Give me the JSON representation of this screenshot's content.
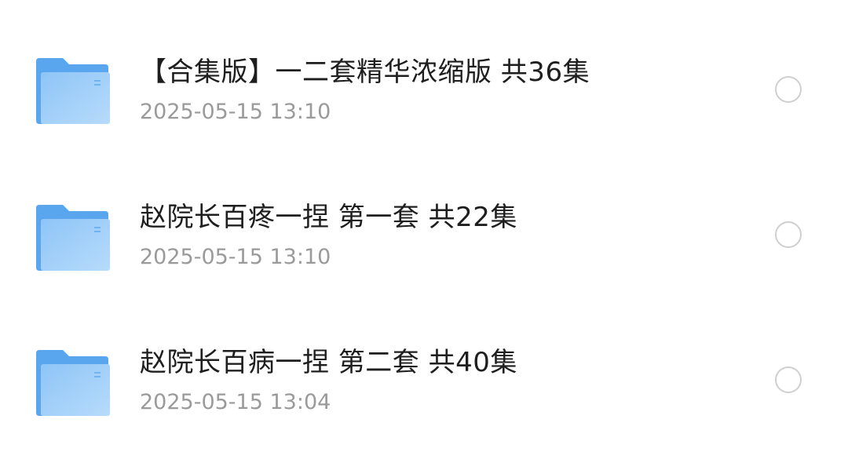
{
  "files": [
    {
      "name": "【合集版】一二套精华浓缩版 共36集",
      "date": "2025-05-15 13:10",
      "icon": "folder-icon"
    },
    {
      "name": "赵院长百疼一捏 第一套 共22集",
      "date": "2025-05-15 13:10",
      "icon": "folder-icon"
    },
    {
      "name": "赵院长百病一捏 第二套 共40集",
      "date": "2025-05-15 13:04",
      "icon": "folder-icon"
    }
  ],
  "colors": {
    "folder_back": "#5aa6ee",
    "folder_front_start": "#8ec5f7",
    "folder_front_end": "#b7dbfb",
    "title_text": "#1e1e1e",
    "date_text": "#9a9a9a",
    "select_circle": "#cfcfcf"
  }
}
